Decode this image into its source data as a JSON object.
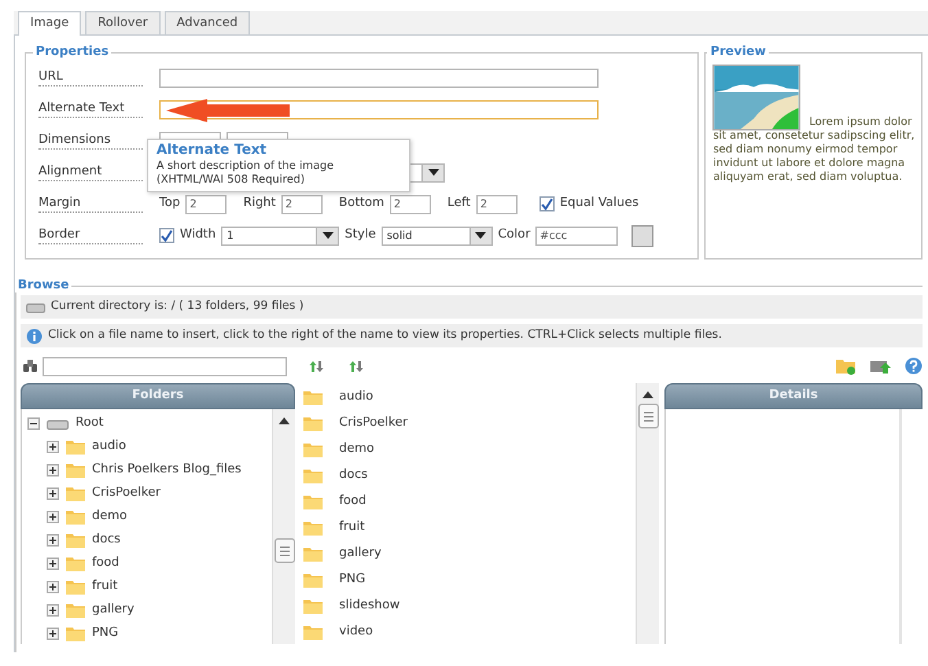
{
  "tabs": [
    {
      "label": "Image",
      "selected": true
    },
    {
      "label": "Rollover",
      "selected": false
    },
    {
      "label": "Advanced",
      "selected": false
    }
  ],
  "properties": {
    "legend": "Properties",
    "url": {
      "label": "URL",
      "focused": false
    },
    "alternate_text": {
      "label": "Alternate Text",
      "focused": true
    },
    "dimensions": {
      "label": "Dimensions"
    },
    "alignment": {
      "label": "Alignment"
    },
    "margin": {
      "label": "Margin",
      "fields": [
        {
          "label": "Top",
          "value": "2"
        },
        {
          "label": "Right",
          "value": "2"
        },
        {
          "label": "Bottom",
          "value": "2"
        },
        {
          "label": "Left",
          "value": "2"
        }
      ],
      "equal_values": {
        "label": "Equal Values",
        "checked": true
      }
    },
    "border": {
      "label": "Border",
      "width": {
        "label": "Width",
        "checked": true,
        "value": "1"
      },
      "style": {
        "label": "Style",
        "value": "solid"
      },
      "color": {
        "label": "Color",
        "value": "#ccc"
      }
    }
  },
  "tooltip": {
    "title": "Alternate Text",
    "text": "A short description of the image",
    "note": "(XHTML/WAI 508 Required)"
  },
  "preview": {
    "legend": "Preview",
    "text": "Lorem ipsum dolor sit amet, consetetur sadipscing elitr, sed diam nonumy eirmod tempor invidunt ut labore et dolore magna aliquyam erat, sed diam voluptua."
  },
  "browse": {
    "legend": "Browse",
    "current_directory": "Current directory is: / ( 13 folders, 99 files )",
    "info": "Click on a file name to insert, click to the right of the name to view its properties. CTRL+Click selects multiple files.",
    "folders_header": "Folders",
    "tree": {
      "label": "Root",
      "expanded": true,
      "children": [
        {
          "label": "audio",
          "expanded": false
        },
        {
          "label": "Chris Poelkers Blog_files",
          "expanded": false
        },
        {
          "label": "CrisPoelker",
          "expanded": false
        },
        {
          "label": "demo",
          "expanded": false
        },
        {
          "label": "docs",
          "expanded": false
        },
        {
          "label": "food",
          "expanded": false
        },
        {
          "label": "fruit",
          "expanded": false
        },
        {
          "label": "gallery",
          "expanded": false
        },
        {
          "label": "PNG",
          "expanded": false
        }
      ]
    },
    "files": [
      "audio",
      "CrisPoelker",
      "demo",
      "docs",
      "food",
      "fruit",
      "gallery",
      "PNG",
      "slideshow",
      "video"
    ],
    "details_header": "Details"
  }
}
